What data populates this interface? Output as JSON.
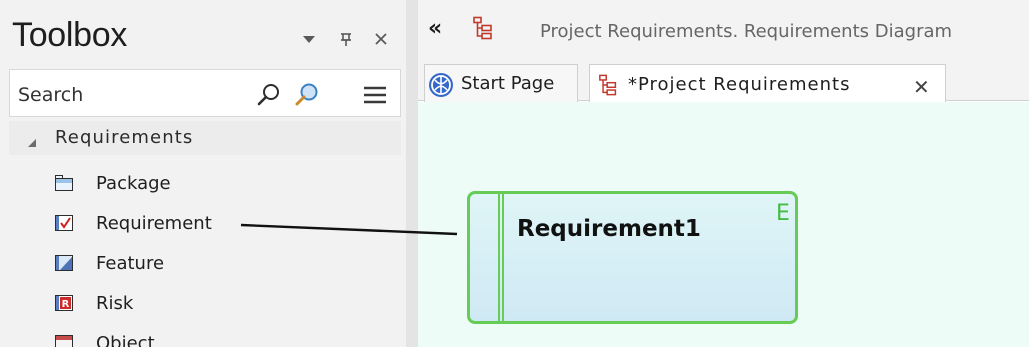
{
  "toolbox": {
    "title": "Toolbox",
    "search": {
      "placeholder": "Search"
    },
    "group": {
      "label": "Requirements",
      "expanded": true
    },
    "items": [
      {
        "label": "Package",
        "icon": "package-icon"
      },
      {
        "label": "Requirement",
        "icon": "requirement-icon"
      },
      {
        "label": "Feature",
        "icon": "feature-icon"
      },
      {
        "label": "Risk",
        "icon": "risk-icon"
      },
      {
        "label": "Object",
        "icon": "object-icon"
      }
    ]
  },
  "document": {
    "collapse_glyph": "«",
    "breadcrumb": "Project Requirements.  Requirements Diagram",
    "tabs": [
      {
        "label": "Start Page",
        "icon": "start-page-icon",
        "active": false
      },
      {
        "label": "*Project Requirements",
        "icon": "diagram-icon",
        "active": true,
        "close_glyph": "✕"
      }
    ]
  },
  "canvas": {
    "element": {
      "name": "Requirement1",
      "stereotype": "E"
    }
  },
  "colors": {
    "element_border": "#66cc55",
    "canvas_background": "#eefcf7",
    "diagram_icon": "#c0392b"
  }
}
